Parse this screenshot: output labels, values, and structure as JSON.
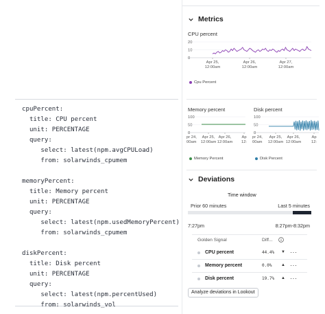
{
  "code": {
    "lines": [
      "cpuPercent:",
      "  title: CPU percent",
      "  unit: PERCENTAGE",
      "  query:",
      "     select: latest(npm.avgCPULoad)",
      "     from: solarwinds_cpumem",
      "",
      "memoryPercent:",
      "  title: Memory percent",
      "  unit: PERCENTAGE",
      "  query:",
      "     select: latest(npm.usedMemoryPercent)",
      "     from: solarwinds_cpumem",
      "",
      "diskPercent:",
      "  title: Disk percent",
      "  unit: PERCENTAGE",
      "  query:",
      "     select: latest(npm.percentUsed)",
      "     from: solarwinds_vol"
    ]
  },
  "metrics": {
    "title": "Metrics",
    "icons": {
      "collapse": "chevron-down-icon"
    },
    "cpu": {
      "label": "CPU percent",
      "legend": "Cpu Percent",
      "color": "#8b3fb3"
    },
    "memory": {
      "label": "Memory percent",
      "legend": "Memory Percent",
      "color": "#3d8f4a"
    },
    "disk": {
      "label": "Disk percent",
      "legend": "Disk Percent",
      "color": "#2f7ea8"
    }
  },
  "chart_data": [
    {
      "type": "line",
      "title": "CPU percent",
      "yticks": [
        "20",
        "10",
        "0"
      ],
      "ylim": [
        0,
        20
      ],
      "xticks": [
        [
          "Apr 25,",
          "12:00am"
        ],
        [
          "Apr 26,",
          "12:00am"
        ],
        [
          "Apr 27,",
          "12:00am"
        ]
      ],
      "series": [
        {
          "name": "Cpu Percent",
          "color": "#8b3fb3",
          "values": [
            5,
            6,
            5,
            7,
            8,
            6,
            7,
            9,
            8,
            10,
            9,
            7,
            8,
            11,
            9,
            12,
            10,
            8,
            9,
            10,
            11,
            13,
            10,
            9,
            8,
            10,
            12,
            11,
            9,
            8,
            7,
            9,
            10,
            8,
            9,
            11,
            10,
            12,
            9,
            8,
            10,
            9,
            11,
            10,
            8,
            7,
            9,
            8,
            10,
            11,
            9,
            13,
            10,
            9,
            8,
            10,
            12,
            9,
            11,
            10,
            9,
            8,
            10,
            11,
            9,
            10,
            14,
            11,
            10,
            9
          ]
        }
      ]
    },
    {
      "type": "line",
      "title": "Memory percent",
      "yticks": [
        "100",
        "50",
        "0"
      ],
      "ylim": [
        0,
        100
      ],
      "xticks": [
        [
          "Apr 25,",
          "12:00am"
        ],
        [
          "Apr 26,",
          "12:00am"
        ],
        [
          "Ap",
          "12:"
        ]
      ],
      "xtick_lead": [
        "pr 24,",
        "00am"
      ],
      "series": [
        {
          "name": "Memory Percent",
          "color": "#3d8f4a",
          "values": [
            52,
            52,
            52,
            52,
            52,
            52,
            52,
            52,
            52,
            52,
            52,
            52,
            52,
            52,
            52,
            52
          ]
        }
      ]
    },
    {
      "type": "line",
      "title": "Disk percent",
      "yticks": [
        "100",
        "50",
        "0"
      ],
      "ylim": [
        0,
        100
      ],
      "xticks": [
        [
          "Apr 25,",
          "12:00am"
        ],
        [
          "Apr 26,",
          "12:00am"
        ],
        [
          "Ap",
          "12:"
        ]
      ],
      "xtick_lead": [
        "pr 24,",
        "00am"
      ],
      "series": [
        {
          "name": "Disk Percent",
          "color": "#2f7ea8",
          "values": [
            40,
            40,
            40,
            40,
            40,
            40,
            40,
            40,
            40,
            40,
            40,
            40,
            40,
            40,
            40,
            40,
            40,
            40,
            40,
            40,
            40,
            40,
            40,
            40,
            40,
            40,
            40,
            40,
            40,
            40,
            70,
            20,
            75,
            15,
            72,
            18,
            78,
            12,
            70,
            22,
            76,
            14,
            73,
            19,
            77,
            16,
            71,
            21,
            74,
            13,
            79,
            17,
            72,
            20,
            75,
            15,
            70,
            18,
            76,
            14
          ]
        }
      ]
    }
  ],
  "deviations": {
    "title": "Deviations",
    "time_window": {
      "title": "Time window",
      "left_label": "Prior 60 minutes",
      "right_label": "Last 5 minutes",
      "start_time": "7:27pm",
      "end_time": "8:27pm-8:32pm",
      "recent_fraction": 0.15
    },
    "table": {
      "col_signal": "Golden Signal",
      "col_diff": "Diff...",
      "info_icon": "info-icon",
      "rows": [
        {
          "name": "CPU percent",
          "diff": "44.4%",
          "arrow": "▼",
          "more": "···"
        },
        {
          "name": "Memory percent",
          "diff": "0.0%",
          "arrow": "▲",
          "more": "···"
        },
        {
          "name": "Disk percent",
          "diff": "19.7%",
          "arrow": "▲",
          "more": "···"
        }
      ]
    },
    "button_label": "Analyze deviations in Lookout"
  }
}
